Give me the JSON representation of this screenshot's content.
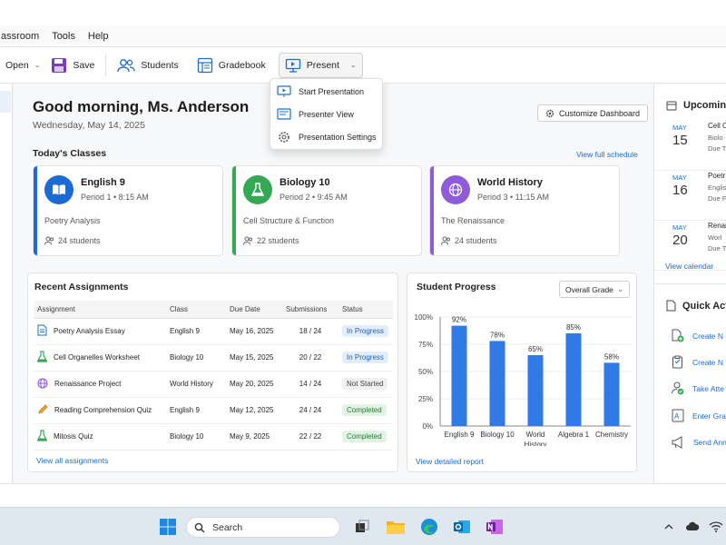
{
  "menu": [
    "assroom",
    "Tools",
    "Help"
  ],
  "toolbar": {
    "open": "Open",
    "save": "Save",
    "students": "Students",
    "gradebook": "Gradebook",
    "present": "Present"
  },
  "present_menu": [
    "Start Presentation",
    "Presenter View",
    "Presentation Settings"
  ],
  "header": {
    "greeting": "Good morning, Ms. Anderson",
    "date": "Wednesday, May 14, 2025",
    "customize": "Customize Dashboard"
  },
  "todays_classes": {
    "title": "Today's Classes",
    "view_all": "View full schedule",
    "cards": [
      {
        "title": "English 9",
        "period": "Period 1 • 8:15 AM",
        "topic": "Poetry Analysis",
        "students": "24 students",
        "color": "#1a6cd4"
      },
      {
        "title": "Biology 10",
        "period": "Period 2 • 9:45 AM",
        "topic": "Cell Structure & Function",
        "students": "22 students",
        "color": "#34a853"
      },
      {
        "title": "World History",
        "period": "Period 3 • 11:15 AM",
        "topic": "The Renaissance",
        "students": "24 students",
        "color": "#8e5cd9"
      }
    ]
  },
  "assignments": {
    "title": "Recent Assignments",
    "columns": [
      "Assignment",
      "Class",
      "Due Date",
      "Submissions",
      "Status"
    ],
    "rows": [
      {
        "name": "Poetry Analysis Essay",
        "class": "English 9",
        "due": "May 16, 2025",
        "subs": "18 / 24",
        "status": "In Progress",
        "icon": "document-icon"
      },
      {
        "name": "Cell Organelles Worksheet",
        "class": "Biology 10",
        "due": "May 15, 2025",
        "subs": "20 / 22",
        "status": "In Progress",
        "icon": "flask-icon"
      },
      {
        "name": "Renaissance Project",
        "class": "World History",
        "due": "May 20, 2025",
        "subs": "14 / 24",
        "status": "Not Started",
        "icon": "globe-icon"
      },
      {
        "name": "Reading Comprehension Quiz",
        "class": "English 9",
        "due": "May 12, 2025",
        "subs": "24 / 24",
        "status": "Completed",
        "icon": "pencil-icon"
      },
      {
        "name": "Mitosis Quiz",
        "class": "Biology 10",
        "due": "May 9, 2025",
        "subs": "22 / 22",
        "status": "Completed",
        "icon": "flask-icon"
      }
    ],
    "view_all": "View all assignments"
  },
  "progress": {
    "title": "Student Progress",
    "select": "Overall Grade",
    "view_report": "View detailed report"
  },
  "chart_data": {
    "type": "bar",
    "title": "Student Progress",
    "categories": [
      "English 9",
      "Biology 10",
      "World History",
      "Algebra 1",
      "Chemistry"
    ],
    "values": [
      92,
      78,
      65,
      85,
      58
    ],
    "data_labels": [
      "92%",
      "78%",
      "65%",
      "85%",
      "58%"
    ],
    "ylim": [
      0,
      100
    ],
    "yticks": [
      "0%",
      "25%",
      "50%",
      "75%",
      "100%"
    ],
    "bar_color": "#2f7ae5"
  },
  "upcoming": {
    "title": "Upcoming",
    "items": [
      {
        "month": "MAY",
        "day": "15",
        "l1": "Cell O",
        "l2": "Biolo",
        "l3": "Due T"
      },
      {
        "month": "MAY",
        "day": "16",
        "l1": "Poetr",
        "l2": "Englis",
        "l3": "Due F"
      },
      {
        "month": "MAY",
        "day": "20",
        "l1": "Renai",
        "l2": "Worl",
        "l3": "Due T"
      }
    ],
    "view_calendar": "View calendar"
  },
  "quick_actions": {
    "title": "Quick Acti",
    "items": [
      "Create N",
      "Create N",
      "Take Atte",
      "Enter Gra",
      "Send Ann"
    ]
  },
  "taskbar": {
    "search": "Search"
  }
}
